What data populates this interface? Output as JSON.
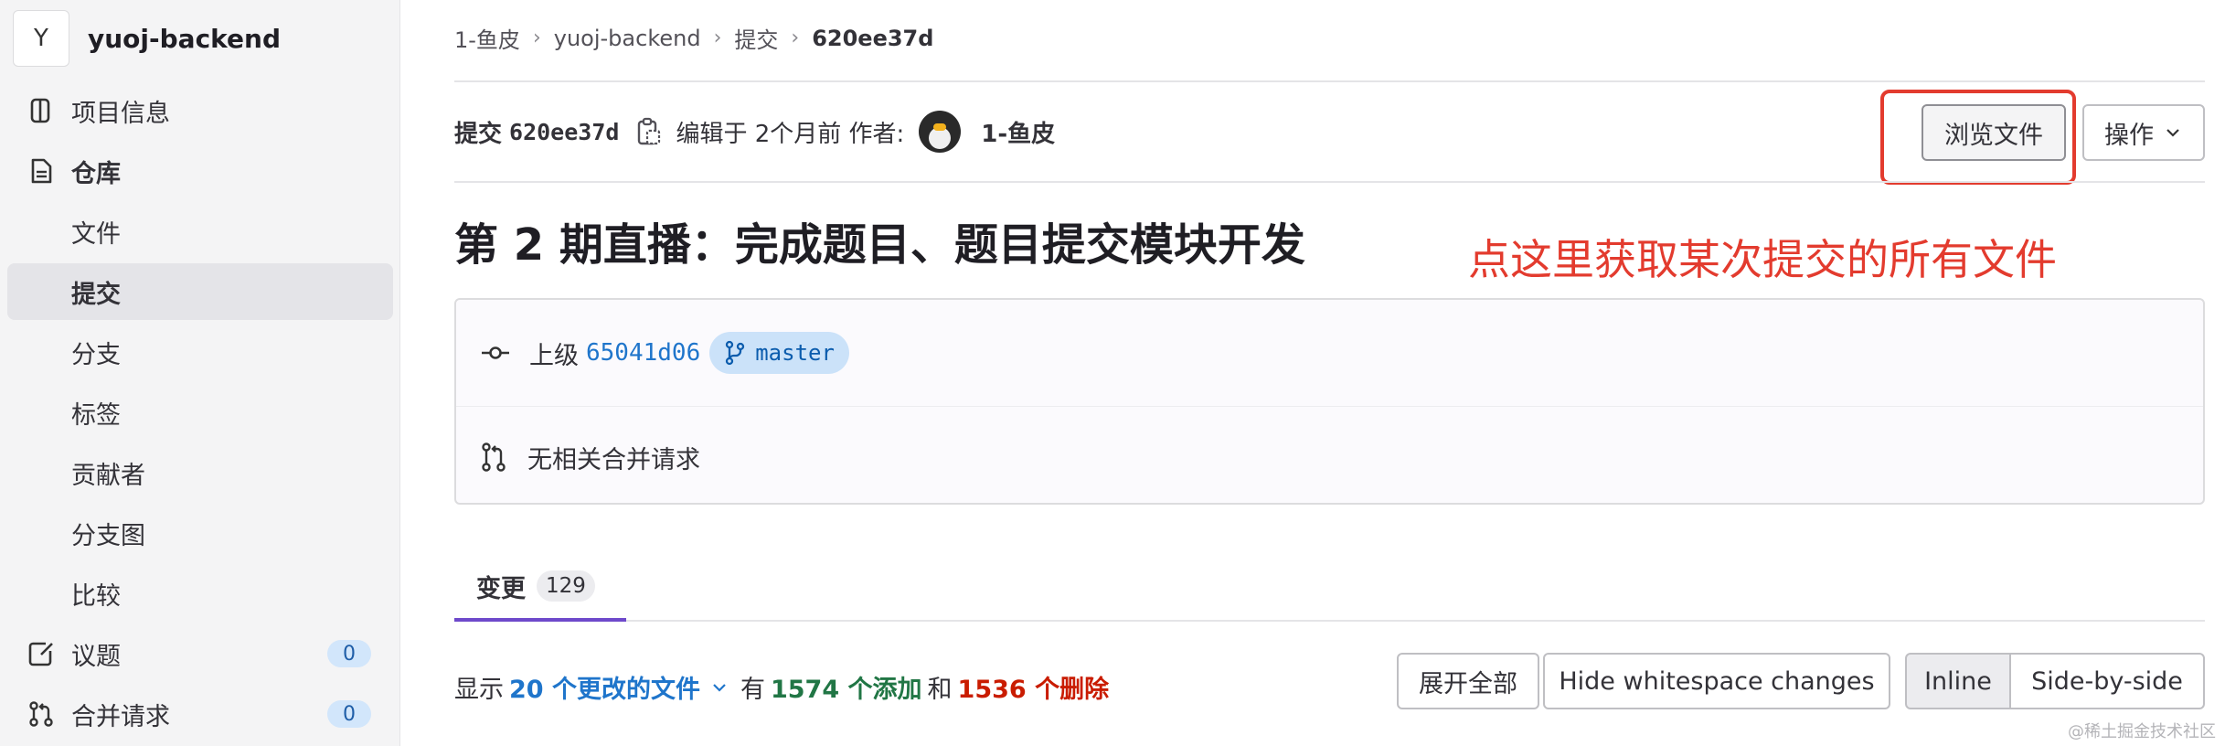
{
  "sidebar": {
    "project_initial": "Y",
    "project_name": "yuoj-backend",
    "items": [
      {
        "label": "项目信息"
      },
      {
        "label": "仓库"
      },
      {
        "label": "文件"
      },
      {
        "label": "提交"
      },
      {
        "label": "分支"
      },
      {
        "label": "标签"
      },
      {
        "label": "贡献者"
      },
      {
        "label": "分支图"
      },
      {
        "label": "比较"
      },
      {
        "label": "议题",
        "badge": "0"
      },
      {
        "label": "合并请求",
        "badge": "0"
      }
    ]
  },
  "breadcrumb": [
    "1-鱼皮",
    "yuoj-backend",
    "提交",
    "620ee37d"
  ],
  "commit": {
    "prefix": "提交",
    "id": "620ee37d",
    "edited": "编辑于 2个月前 作者:",
    "author": "1-鱼皮",
    "browse_files_label": "浏览文件",
    "actions_label": "操作",
    "title": "第 2 期直播：完成题目、题目提交模块开发",
    "parent_label": "上级",
    "parent_sha": "65041d06",
    "branch": "master",
    "merge_requests_text": "无相关合并请求"
  },
  "annotation": "点这里获取某次提交的所有文件",
  "changes": {
    "tab_label": "变更",
    "count": "129",
    "show_prefix": "显示",
    "files_changed": "20 个更改的文件",
    "has": "有",
    "additions": "1574 个添加",
    "and": "和",
    "deletions": "1536 个删除"
  },
  "toolbar": {
    "expand_all": "展开全部",
    "hide_whitespace": "Hide whitespace changes",
    "inline": "Inline",
    "side_by_side": "Side-by-side"
  },
  "watermark": "@稀土掘金技术社区",
  "colors": {
    "accent": "#1f75cb",
    "annotation": "#e33b2e",
    "tab_underline": "#6e49cb",
    "additions": "#217645",
    "deletions": "#c91c00"
  }
}
